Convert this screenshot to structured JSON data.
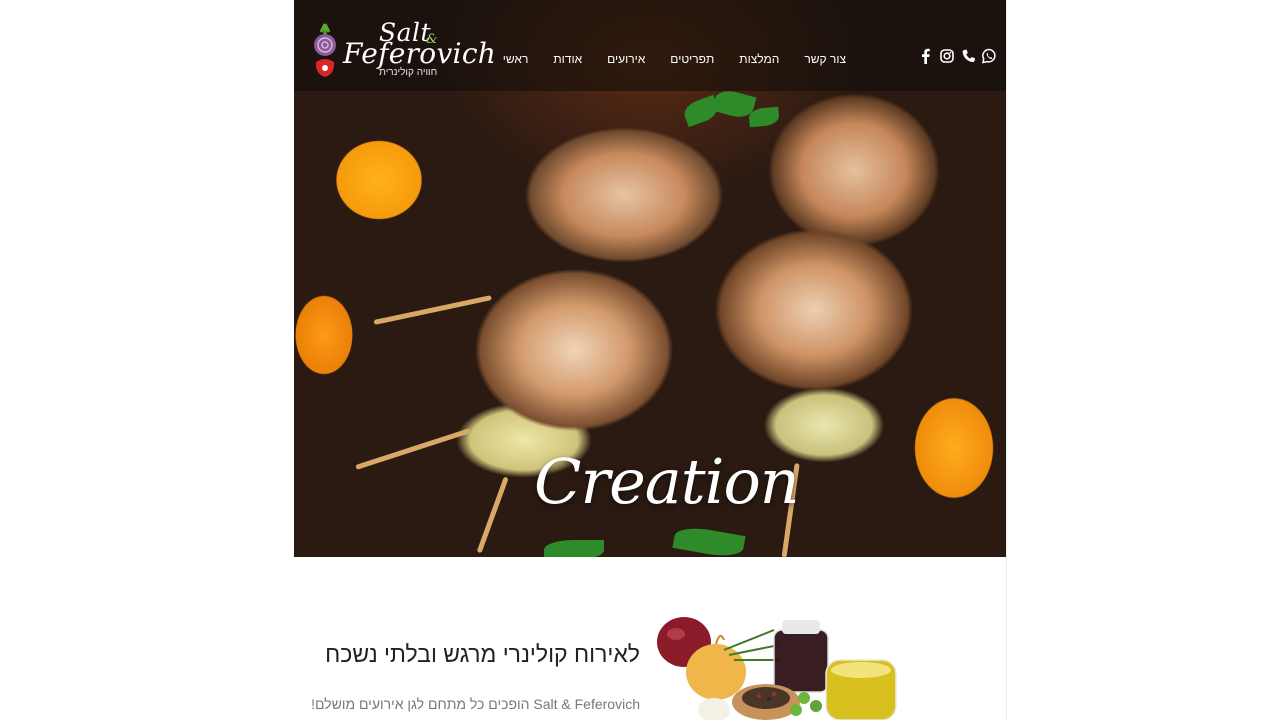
{
  "brand": {
    "logo_line1": "Salt",
    "logo_amp": "&",
    "logo_line2": "Feferovich",
    "logo_subtitle": "חוויה קולינרית"
  },
  "nav": {
    "items": [
      {
        "label": "ראשי"
      },
      {
        "label": "אודות"
      },
      {
        "label": "אירועים"
      },
      {
        "label": "תפריטים"
      },
      {
        "label": "המלצות"
      },
      {
        "label": "צור קשר"
      }
    ]
  },
  "social": {
    "icons": [
      "whatsapp-icon",
      "phone-icon",
      "instagram-icon",
      "facebook-icon"
    ]
  },
  "hero": {
    "overlay_text": "Creation"
  },
  "intro": {
    "headline": "לאירוח קולינרי מרגש ובלתי נשכח",
    "tagline": "Salt & Feferovich הופכים כל מתחם לגן אירועים מושלם!"
  },
  "colors": {
    "header_overlay": "#0f0c0a",
    "nav_text": "#ffffff",
    "headline": "#222222",
    "tagline": "#777777"
  }
}
